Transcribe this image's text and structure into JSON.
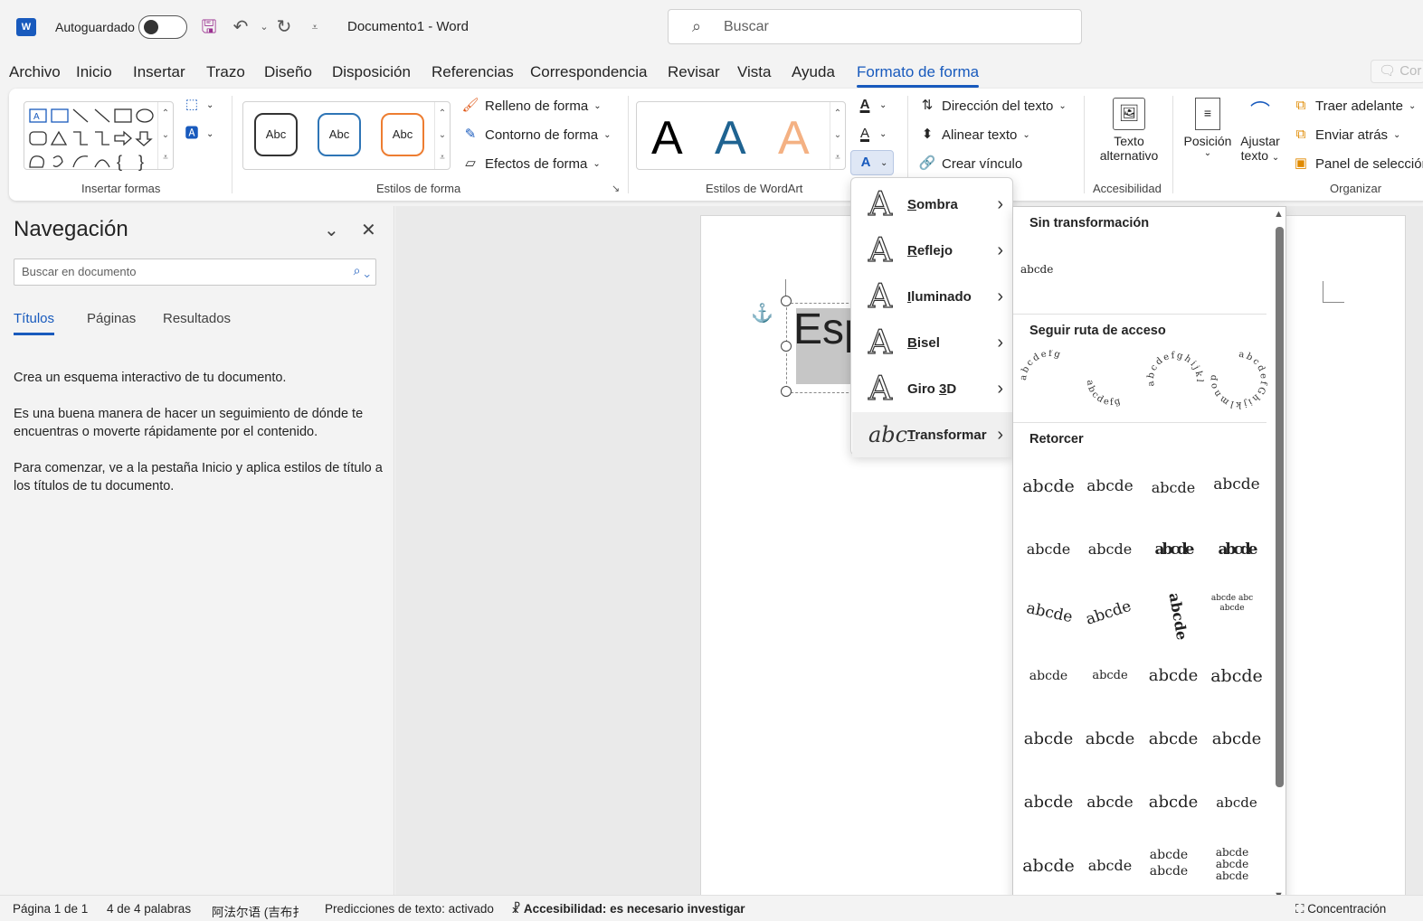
{
  "titlebar": {
    "autosave_label": "Autoguardado",
    "doc_title": "Documento1  -  Word",
    "search_placeholder": "Buscar"
  },
  "menu_tabs": [
    "Archivo",
    "Inicio",
    "Insertar",
    "Trazo",
    "Diseño",
    "Disposición",
    "Referencias",
    "Correspondencia",
    "Revisar",
    "Vista",
    "Ayuda",
    "Formato de forma"
  ],
  "active_tab": "Formato de forma",
  "comment_button": "Cor",
  "ribbon": {
    "groups": {
      "insert_shapes": "Insertar formas",
      "shape_styles": "Estilos de forma",
      "wordart_styles": "Estilos de WordArt",
      "accessibility": "Accesibilidad",
      "arrange": "Organizar"
    },
    "shape_style_samples": [
      "Abc",
      "Abc",
      "Abc"
    ],
    "shape_buttons": {
      "fill": "Relleno de forma",
      "outline": "Contorno de forma",
      "effects": "Efectos de forma"
    },
    "wordart_letters": [
      "A",
      "A",
      "A"
    ],
    "text_buttons": {
      "direction": "Dirección del texto",
      "align": "Alinear texto",
      "link": "Crear vínculo"
    },
    "alt_text": [
      "Texto",
      "alternativo"
    ],
    "position": "Posición",
    "wrap_text": [
      "Ajustar",
      "texto"
    ],
    "arrange_buttons": {
      "bring_forward": "Traer adelante",
      "send_backward": "Enviar atrás",
      "selection_pane": "Panel de selección"
    }
  },
  "nav_pane": {
    "title": "Navegación",
    "search_placeholder": "Buscar en documento",
    "tabs": [
      "Títulos",
      "Páginas",
      "Resultados"
    ],
    "paragraphs": [
      "Crea un esquema interactivo de tu documento.",
      "Es una buena manera de hacer un seguimiento de dónde te encuentras o moverte rápidamente por el contenido.",
      "Para comenzar, ve a la pestaña Inicio y aplica estilos de título a los títulos de tu documento."
    ]
  },
  "document": {
    "wordart_text": "Esp"
  },
  "effects_menu": [
    {
      "key": "S",
      "rest": "ombra"
    },
    {
      "key": "R",
      "rest": "eflejo"
    },
    {
      "key": "I",
      "rest": "luminado"
    },
    {
      "key": "B",
      "rest": "isel"
    },
    {
      "pre": "Giro ",
      "key": "3",
      "rest": "D"
    },
    {
      "key": "T",
      "rest": "ransformar"
    }
  ],
  "transform_menu": {
    "no_transform_heading": "Sin transformación",
    "no_transform_sample": "abcde",
    "follow_path_heading": "Seguir ruta de acceso",
    "follow_path_samples": [
      "abcdefg",
      "abcdefg",
      "abcdefghijklm",
      "abcdefGhijklmnop"
    ],
    "warp_heading": "Retorcer",
    "warp_samples": [
      "abcde",
      "abcde",
      "abcde",
      "abcde",
      "abcde",
      "abcde",
      "abcde",
      "abcde",
      "abcde",
      "abcde",
      "abcde",
      "abcde abc abcde",
      "abcde",
      "abcde",
      "abcde",
      "abcde",
      "abcde",
      "abcde",
      "abcde",
      "abcde",
      "abcde",
      "abcde",
      "abcde",
      "abcde",
      "abcde",
      "abcde",
      "abcde abcde",
      "abcde abcde abcde"
    ]
  },
  "status_bar": {
    "page": "Página 1 de 1",
    "words": "4 de 4 palabras",
    "language": "阿法尔语 (吉布扌",
    "predictions": "Predicciones de texto: activado",
    "accessibility": "Accesibilidad: es necesario investigar",
    "focus": "Concentración"
  },
  "colors": {
    "accent": "#185abd",
    "shape_style_2": "#2e75b6",
    "shape_style_3": "#ed7d31",
    "wordart_blue": "#1f6391",
    "wordart_orange": "#f4b183"
  }
}
